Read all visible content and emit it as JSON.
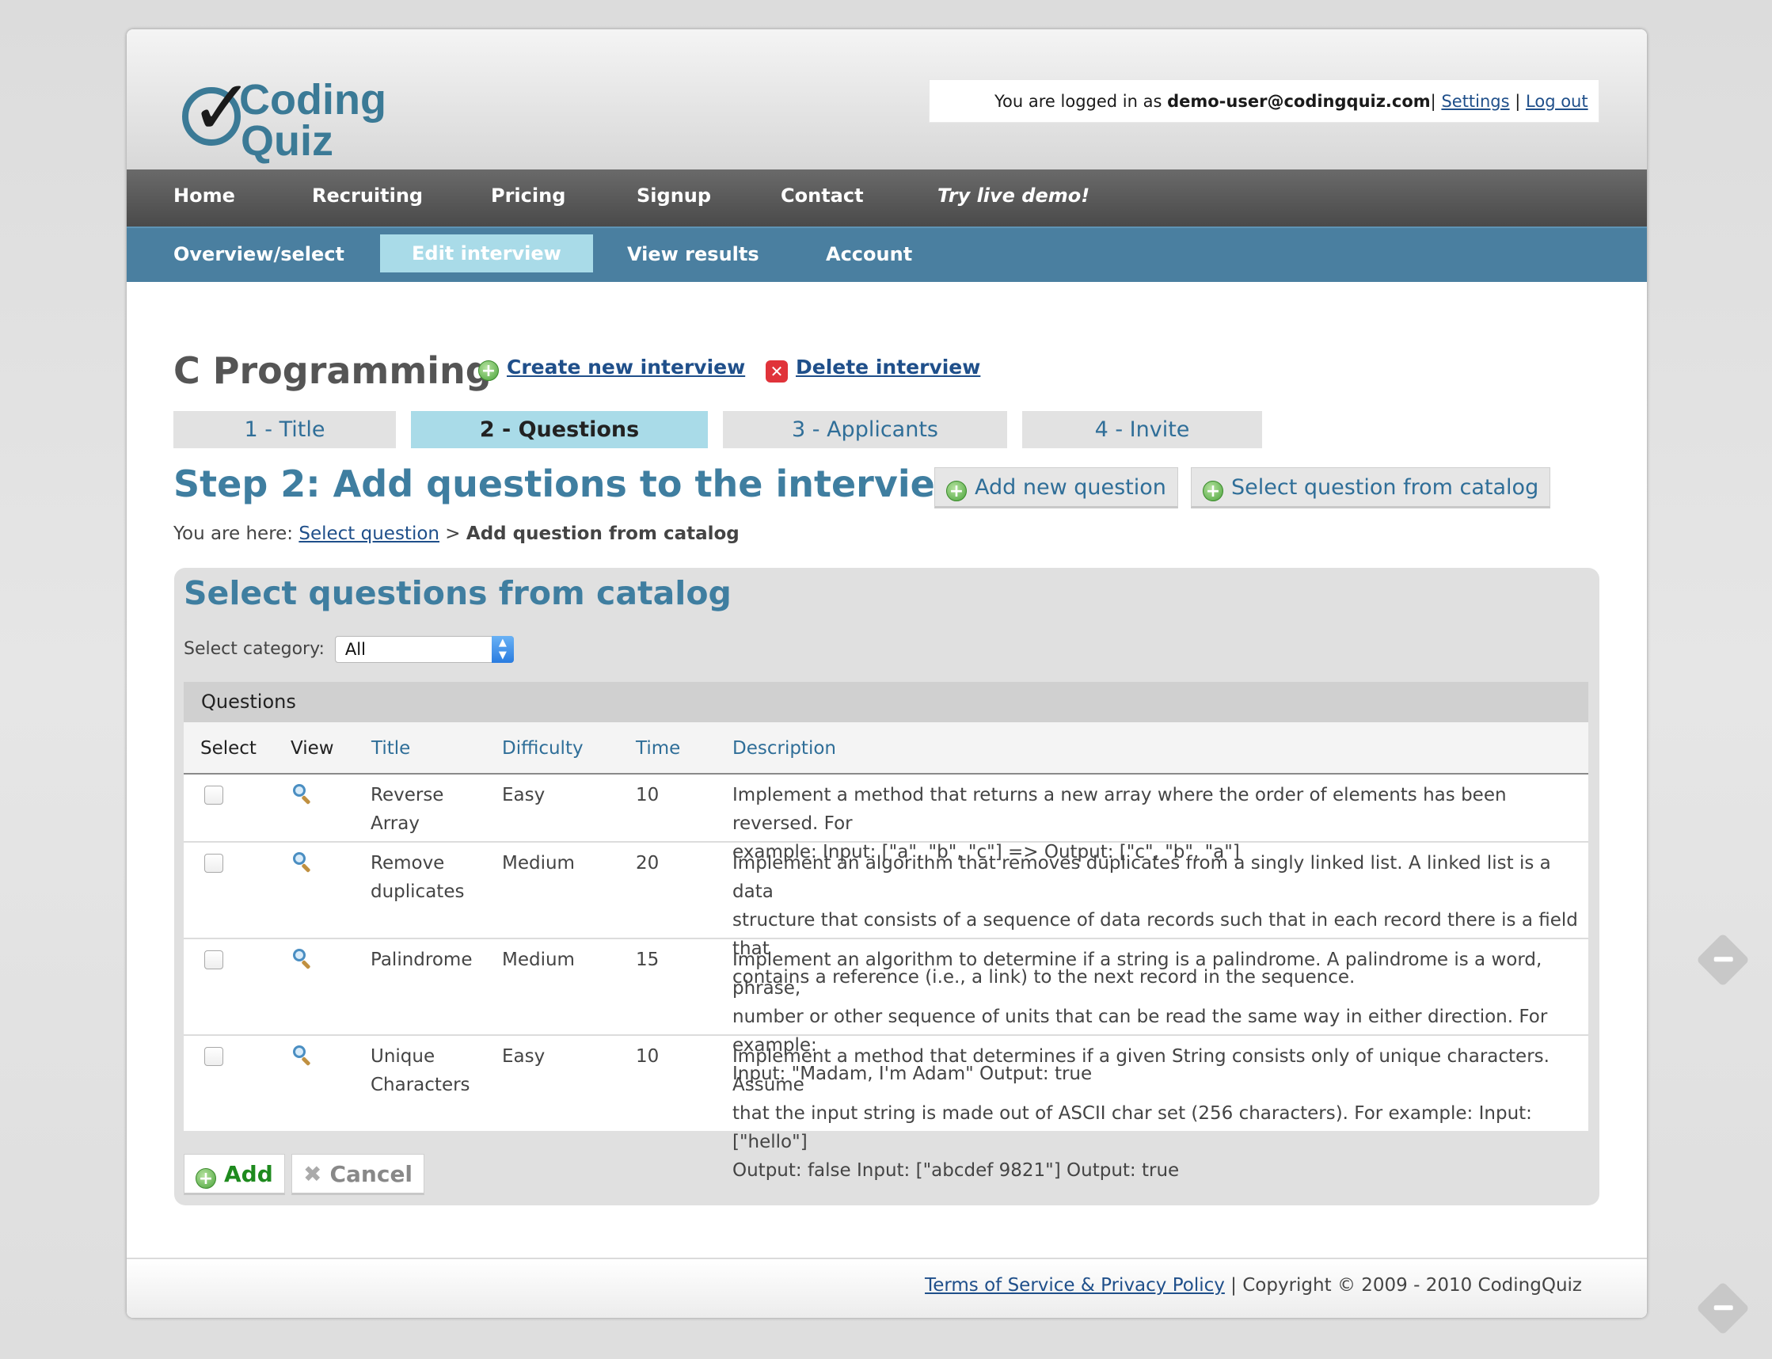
{
  "logo": {
    "line1": "Coding",
    "line2": "Quiz"
  },
  "user": {
    "logged_in_prefix": "You are logged in as ",
    "email": "demo-user@codingquiz.com",
    "sep1": "| ",
    "settings": "Settings",
    "sep2": " | ",
    "logout": "Log out"
  },
  "mainnav": [
    "Home",
    "Recruiting",
    "Pricing",
    "Signup",
    "Contact",
    "Try live demo!"
  ],
  "subnav": [
    "Overview/select",
    "Edit interview",
    "View results",
    "Account"
  ],
  "page": {
    "title": "C Programming",
    "create_link": "Create new interview",
    "delete_link": "Delete interview"
  },
  "steps": [
    "1 - Title",
    "2 - Questions",
    "3 - Applicants",
    "4 - Invite"
  ],
  "step_title": "Step 2: Add questions to the interview",
  "buttons": {
    "add_new_question": "Add new question",
    "select_from_catalog": "Select question from catalog"
  },
  "breadcrumb": {
    "prefix": "You are here: ",
    "link": "Select question",
    "sep": " > ",
    "current": "Add question from catalog"
  },
  "catalog": {
    "heading": "Select questions from catalog",
    "category_label": "Select category:",
    "category_value": "All",
    "table_caption": "Questions",
    "columns": [
      "Select",
      "View",
      "Title",
      "Difficulty",
      "Time",
      "Description"
    ],
    "rows": [
      {
        "title_lines": [
          "Reverse",
          "Array"
        ],
        "difficulty": "Easy",
        "time": "10",
        "description_lines": [
          "Implement a method that returns a new array where the order of elements has been reversed. For",
          "example: Input: [\"a\", \"b\", \"c\"] => Output: [\"c\", \"b\", \"a\"]"
        ]
      },
      {
        "title_lines": [
          "Remove",
          "duplicates"
        ],
        "difficulty": "Medium",
        "time": "20",
        "description_lines": [
          "Implement an algorithm that removes duplicates from a singly linked list. A linked list is a data",
          "structure that consists of a sequence of data records such that in each record there is a field that",
          "contains a reference (i.e., a link) to the next record in the sequence."
        ]
      },
      {
        "title_lines": [
          "Palindrome"
        ],
        "difficulty": "Medium",
        "time": "15",
        "description_lines": [
          "Implement an algorithm to determine if a string is a palindrome. A palindrome is a word, phrase,",
          "number or other sequence of units that can be read the same way in either direction. For example:",
          "Input: \"Madam, I'm Adam\" Output: true"
        ]
      },
      {
        "title_lines": [
          "Unique",
          "Characters"
        ],
        "difficulty": "Easy",
        "time": "10",
        "description_lines": [
          "Implement a method that determines if a given String consists only of unique characters. Assume",
          "that the input string is made out of ASCII char set (256 characters). For example: Input: [\"hello\"]",
          "Output: false Input: [\"abcdef 9821\"] Output: true"
        ]
      }
    ],
    "add_button": "Add",
    "cancel_button": "Cancel"
  },
  "footer": {
    "terms": "Terms of Service & Privacy Policy",
    "copyright": " | Copyright © 2009 - 2010 CodingQuiz"
  },
  "colors": {
    "accent_blue": "#3f7ea0",
    "subnav_blue": "#4a7fa0",
    "active_tab": "#a9dbe8",
    "link": "#1f4f8a"
  }
}
